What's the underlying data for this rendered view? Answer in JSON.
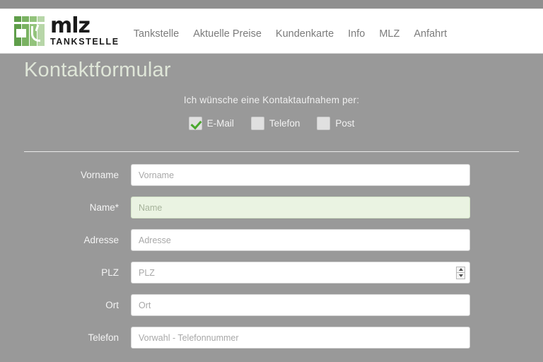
{
  "site": {
    "logo": {
      "name": "mlz",
      "tagline": "TANKSTELLE"
    },
    "nav_items": [
      {
        "label": "Tankstelle"
      },
      {
        "label": "Aktuelle Preise"
      },
      {
        "label": "Kundenkarte"
      },
      {
        "label": "Info"
      },
      {
        "label": "MLZ"
      },
      {
        "label": "Anfahrt"
      }
    ]
  },
  "page": {
    "title": "Kontaktformular"
  },
  "preference": {
    "question": "Ich wünsche eine Kontaktaufnahem per:",
    "options": [
      {
        "label": "E-Mail",
        "checked": true
      },
      {
        "label": "Telefon",
        "checked": false
      },
      {
        "label": "Post",
        "checked": false
      }
    ]
  },
  "form": {
    "fields": [
      {
        "label": "Vorname",
        "placeholder": "Vorname",
        "value": "",
        "required": false,
        "type": "text"
      },
      {
        "label": "Name*",
        "placeholder": "Name",
        "value": "",
        "required": true,
        "type": "text"
      },
      {
        "label": "Adresse",
        "placeholder": "Adresse",
        "value": "",
        "required": false,
        "type": "text"
      },
      {
        "label": "PLZ",
        "placeholder": "PLZ",
        "value": "",
        "required": false,
        "type": "number"
      },
      {
        "label": "Ort",
        "placeholder": "Ort",
        "value": "",
        "required": false,
        "type": "text"
      },
      {
        "label": "Telefon",
        "placeholder": "Vorwahl - Telefonnummer",
        "value": "",
        "required": false,
        "type": "text"
      }
    ]
  },
  "colors": {
    "page_background": "#999999",
    "header_background": "#ffffff",
    "brand_green": "#5f9e4a",
    "check_green": "#4aa82e",
    "required_field_background": "#eaf3e2",
    "title_color": "#dfe6d8",
    "nav_link_color": "#7b7b7b"
  }
}
